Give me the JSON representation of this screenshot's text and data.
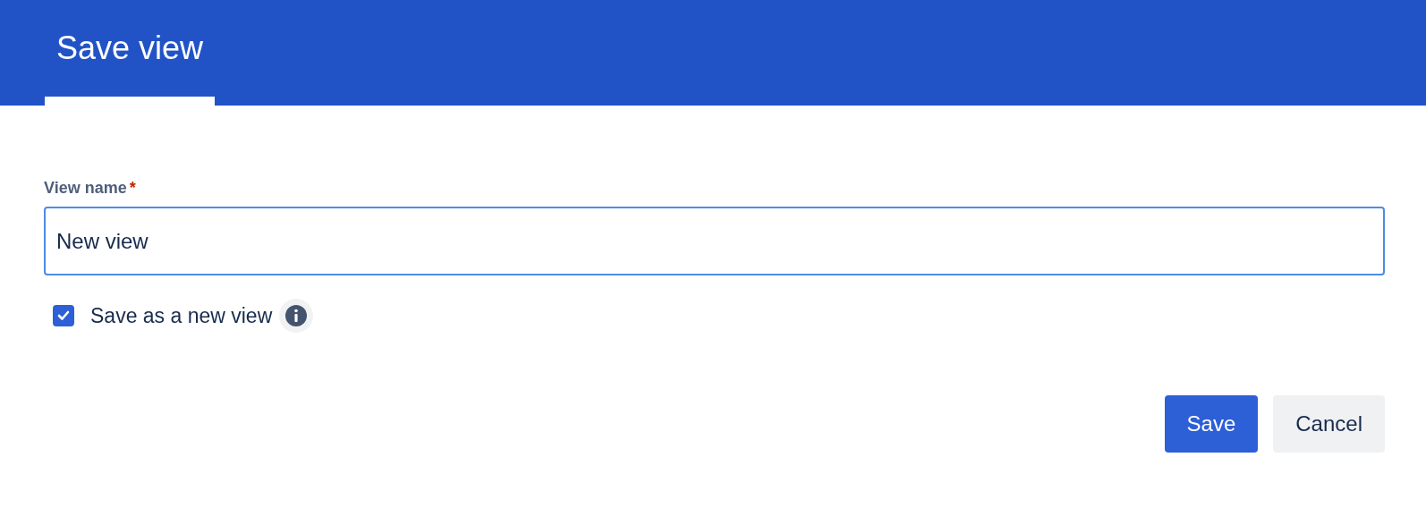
{
  "tabs": [
    {
      "label": "Save view",
      "selected": true
    }
  ],
  "field": {
    "label": "View name",
    "required_mark": "*",
    "value": "New view",
    "focused": true
  },
  "checkbox": {
    "label": "Save as a new view",
    "checked": true
  },
  "buttons": [
    {
      "label": "Save",
      "kind": "primary"
    },
    {
      "label": "Cancel",
      "kind": "secondary"
    }
  ]
}
